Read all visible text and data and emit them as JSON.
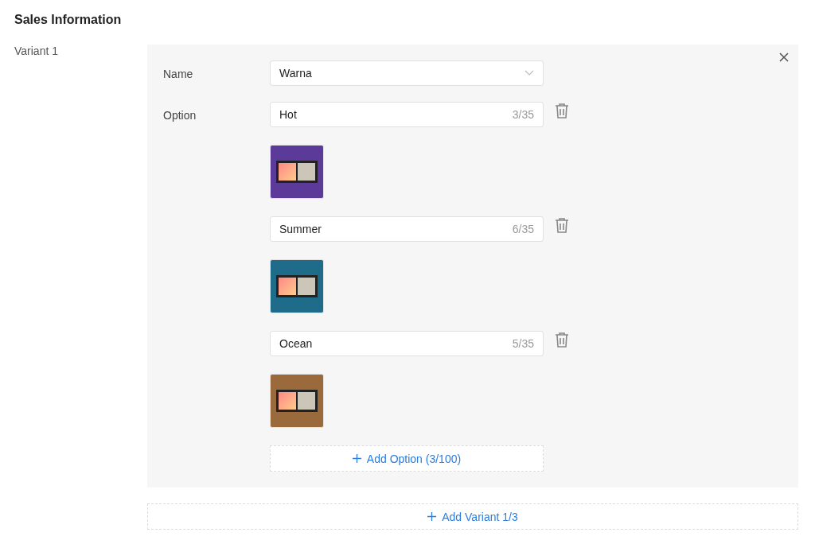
{
  "section_title": "Sales Information",
  "variant": {
    "label": "Variant 1",
    "name_label": "Name",
    "name_value": "Warna",
    "option_label": "Option",
    "options": [
      {
        "value": "Hot",
        "count": "3/35",
        "color": "#5b3a9a"
      },
      {
        "value": "Summer",
        "count": "6/35",
        "color": "#1f6b8a"
      },
      {
        "value": "Ocean",
        "count": "5/35",
        "color": "#9a6a3c"
      }
    ],
    "add_option": "Add Option (3/100)"
  },
  "add_variant": "Add Variant 1/3"
}
